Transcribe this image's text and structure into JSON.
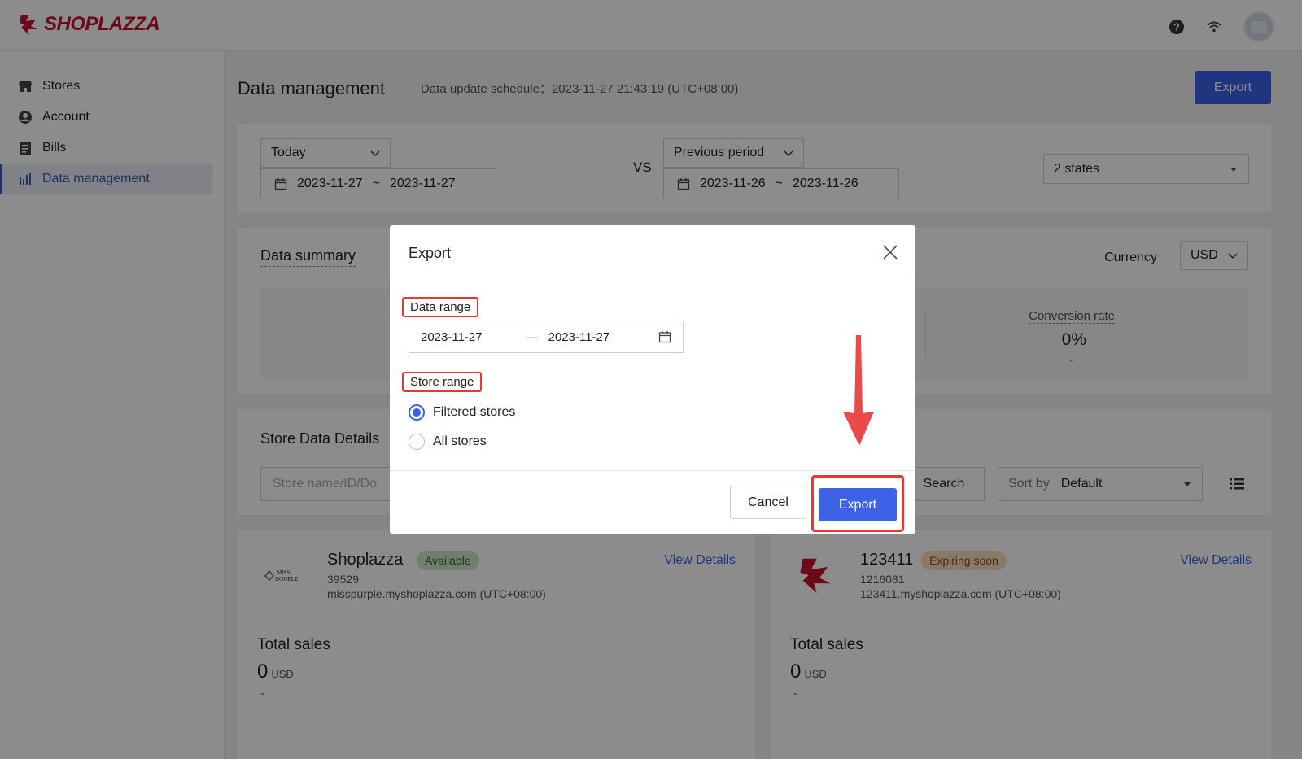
{
  "app": {
    "brand": "SHOPLAZZA"
  },
  "sidebar": {
    "items": [
      {
        "label": "Stores",
        "icon": "store-icon"
      },
      {
        "label": "Account",
        "icon": "account-icon"
      },
      {
        "label": "Bills",
        "icon": "bills-icon"
      },
      {
        "label": "Data management",
        "icon": "bar-chart-icon",
        "active": true
      }
    ]
  },
  "header": {
    "title": "Data management",
    "schedule": "Data update schedule：2023-11-27 21:43:19 (UTC+08:00)",
    "export_label": "Export"
  },
  "filters": {
    "period": "Today",
    "date_start": "2023-11-27",
    "date_sep": "~",
    "date_end": "2023-11-27",
    "vs": "VS",
    "compare_period": "Previous period",
    "compare_start": "2023-11-26",
    "compare_end": "2023-11-26",
    "states": "2 states"
  },
  "summary": {
    "title": "Data summary",
    "currency_label": "Currency",
    "currency": "USD",
    "conversion_label": "Conversion rate",
    "conversion_value": "0%",
    "conversion_change": "-"
  },
  "details": {
    "title": "Store Data Details",
    "search_placeholder": "Store name/ID/Do",
    "search_label": "Search",
    "sort_label": "Sort by",
    "sort_value": "Default"
  },
  "stores": [
    {
      "name": "Shoplazza",
      "badge": "Available",
      "id": "39529",
      "url": "misspurple.myshoplazza.com (UTC+08:00)",
      "view": "View Details",
      "total_label": "Total sales",
      "total_value": "0",
      "unit": "USD",
      "change": "-"
    },
    {
      "name": "123411",
      "badge": "Expiring soon",
      "id": "1216081",
      "url": "123411.myshoplazza.com (UTC+08:00)",
      "view": "View Details",
      "total_label": "Total sales",
      "total_value": "0",
      "unit": "USD",
      "change": "-"
    }
  ],
  "modal": {
    "title": "Export",
    "data_range_label": "Data range",
    "range_start": "2023-11-27",
    "range_sep": "—",
    "range_end": "2023-11-27",
    "store_range_label": "Store range",
    "options": [
      "Filtered stores",
      "All stores"
    ],
    "selected_option": "Filtered stores",
    "cancel_label": "Cancel",
    "export_label": "Export"
  },
  "colors": {
    "accent": "#3d62e5",
    "annotation": "#e53935",
    "brand": "#c8102e"
  }
}
